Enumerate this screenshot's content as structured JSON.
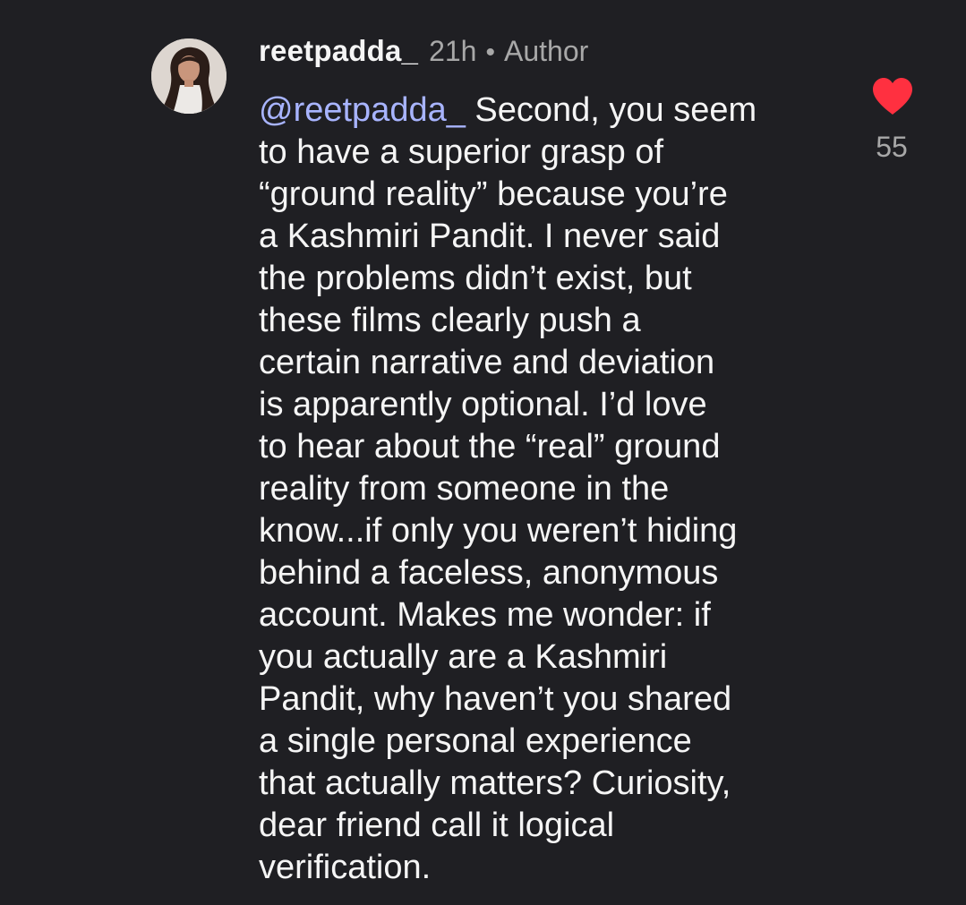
{
  "comment": {
    "username": "reetpadda_",
    "time": "21h",
    "separator": "•",
    "author_label": "Author",
    "mention": "@reetpadda_",
    "lines": [
      " Second, you seem",
      "to have a superior grasp of",
      "“ground reality” because you’re",
      "a Kashmiri Pandit. I never said",
      "the problems didn’t exist, but",
      "these films clearly push a",
      "certain narrative and deviation",
      "is apparently optional. I’d love",
      "to hear about the “real” ground",
      "reality from someone in the",
      "know...if only you weren’t hiding",
      "behind a faceless, anonymous",
      "account. Makes me wonder: if",
      "you actually are a Kashmiri",
      "Pandit, why haven’t you shared",
      "a single personal experience",
      "that actually matters? Curiosity,",
      "dear friend call it logical",
      "verification."
    ],
    "like_icon": "heart-icon",
    "like_count": "55"
  },
  "colors": {
    "background": "#1f1f23",
    "text": "#f5f5f5",
    "secondary": "#a8a8a8",
    "mention": "#a8b4ff",
    "like": "#ff3040"
  }
}
